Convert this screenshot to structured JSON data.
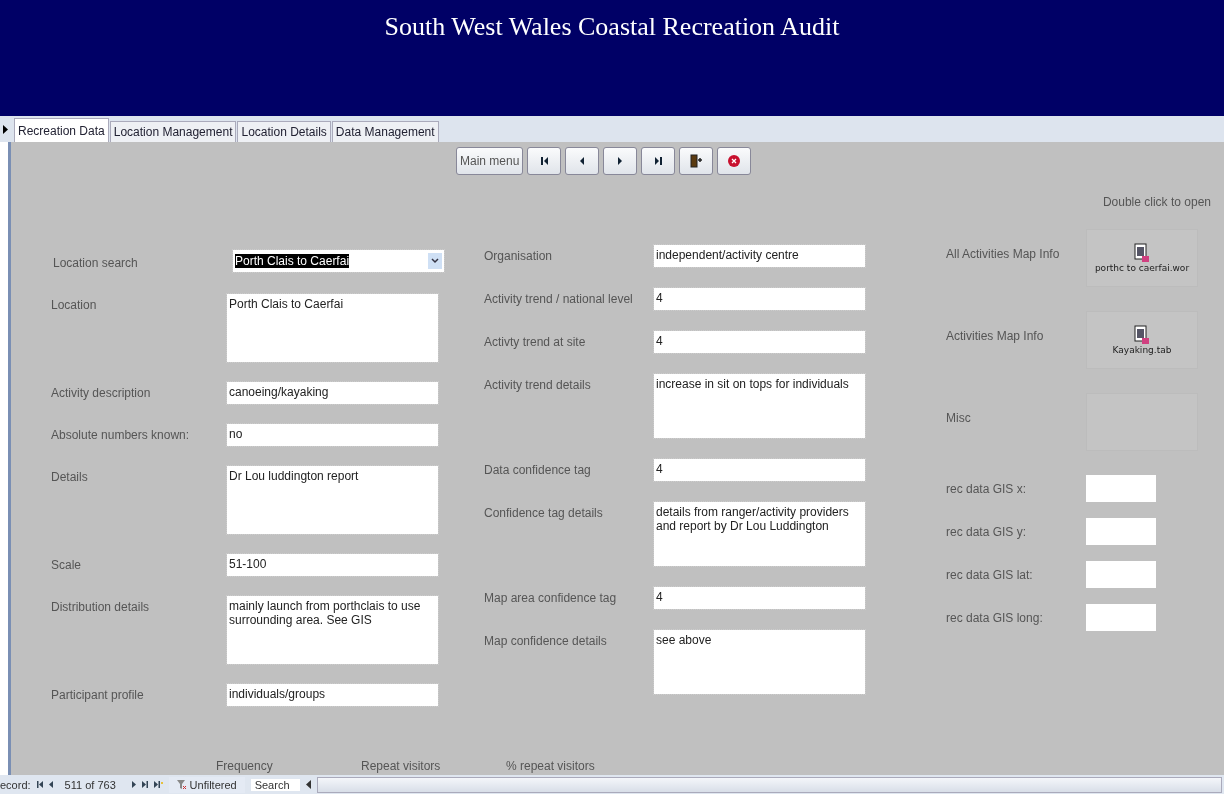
{
  "window": {
    "title": "South West Wales Coastal Recreation Audit"
  },
  "tabs": [
    {
      "label": "Recreation Data",
      "selected": true
    },
    {
      "label": "Location Management",
      "selected": false
    },
    {
      "label": "Location Details",
      "selected": false
    },
    {
      "label": "Data Management",
      "selected": false
    }
  ],
  "toolbar": [
    {
      "kind": "text",
      "label": "Main menu"
    },
    {
      "kind": "first"
    },
    {
      "kind": "previous"
    },
    {
      "kind": "next"
    },
    {
      "kind": "last"
    },
    {
      "kind": "new"
    },
    {
      "kind": "close"
    }
  ],
  "column_1": [
    {
      "label": "Location search",
      "kind": "combo",
      "value": "Porth Clais to Caerfai"
    },
    {
      "label": "Location",
      "kind": "memo",
      "value": "Porth Clais to Caerfai"
    },
    {
      "label": "Activity description",
      "kind": "text",
      "value": "canoeing/kayaking"
    },
    {
      "label": "Absolute numbers known:",
      "kind": "text",
      "value": "no"
    },
    {
      "label": "Details",
      "kind": "memo",
      "value": "Dr Lou luddington report"
    },
    {
      "label": "Scale",
      "kind": "text",
      "value": "51-100"
    },
    {
      "label": "Distribution details",
      "kind": "memo",
      "value": "mainly launch from porthclais to use surrounding area. See GIS"
    },
    {
      "label": "Participant profile",
      "kind": "text",
      "value": "individuals/groups"
    }
  ],
  "column_2": [
    {
      "label": "Organisation",
      "kind": "text",
      "value": "independent/activity centre"
    },
    {
      "label": "Activity trend / national level",
      "kind": "text",
      "value": "4"
    },
    {
      "label": "Activty trend at site",
      "kind": "text",
      "value": "4"
    },
    {
      "label": "Activity trend details",
      "kind": "memo",
      "value": "increase in sit on tops for individuals"
    },
    {
      "label": "Data confidence tag",
      "kind": "text",
      "value": "4"
    },
    {
      "label": "Confidence tag details",
      "kind": "memo",
      "value": "details from ranger/activity providers and report by Dr Lou Luddington"
    },
    {
      "label": "Map area confidence tag",
      "kind": "text",
      "value": "4"
    },
    {
      "label": "Map confidence details",
      "kind": "memo",
      "value": "see above"
    }
  ],
  "column_3_hint": "Double click to open",
  "column_3": [
    {
      "label": "All Activities Map Info",
      "kind": "attachment",
      "file": "porthc to caerfai.wor"
    },
    {
      "label": "Activities Map Info",
      "kind": "attachment",
      "file": "Kayaking.tab"
    },
    {
      "label": "Misc",
      "kind": "empty"
    },
    {
      "label": "rec data GIS x:",
      "kind": "small"
    },
    {
      "label": "rec data GIS y:",
      "kind": "small"
    },
    {
      "label": "rec data GIS lat:",
      "kind": "small"
    },
    {
      "label": "rec data GIS long:",
      "kind": "small"
    }
  ],
  "subform_headers": [
    "Frequency",
    "Repeat visitors",
    "% repeat visitors"
  ],
  "status_bar": {
    "record_label": "ecord:",
    "position": "511 of 763",
    "filter": "Unfiltered",
    "search": "Search"
  }
}
